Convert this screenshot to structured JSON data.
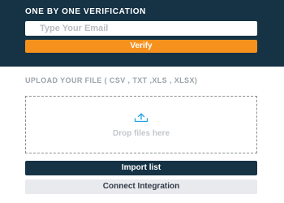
{
  "verification": {
    "title": "ONE BY ONE VERIFICATION",
    "email_placeholder": "Type Your Email",
    "email_value": "",
    "verify_label": "Verify"
  },
  "upload": {
    "label": "UPLOAD YOUR FILE ( CSV , TXT ,XLS , XLSX)",
    "dropzone_text": "Drop files here",
    "icon": "upload-icon"
  },
  "actions": {
    "import_label": "Import list",
    "connect_label": "Connect Integration"
  },
  "colors": {
    "header_bg": "#163346",
    "accent": "#f7911e",
    "upload_icon": "#1da1e2",
    "secondary_button_bg": "#e9eaee"
  }
}
